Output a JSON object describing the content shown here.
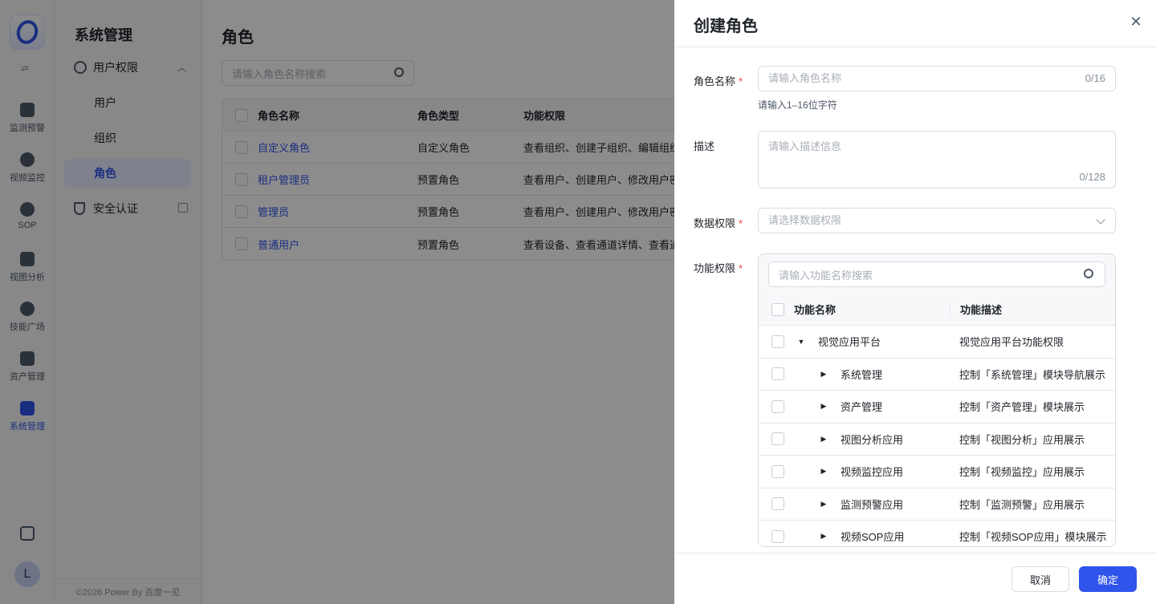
{
  "rail": {
    "items": [
      {
        "label": "监测预警",
        "icon": "monitor-chart-icon"
      },
      {
        "label": "视频监控",
        "icon": "camera-icon"
      },
      {
        "label": "SOP",
        "icon": "sop-icon"
      },
      {
        "label": "视图分析",
        "icon": "view-analysis-icon"
      },
      {
        "label": "技能广场",
        "icon": "skills-icon"
      },
      {
        "label": "资产管理",
        "icon": "asset-icon"
      },
      {
        "label": "系统管理",
        "icon": "system-icon"
      }
    ],
    "avatar": "L"
  },
  "subnav": {
    "title": "系统管理",
    "group": "用户权限",
    "sub_items": [
      "用户",
      "组织",
      "角色"
    ],
    "security": "安全认证",
    "footer": "©2026 Power By 百度一见"
  },
  "main": {
    "title": "角色",
    "search_placeholder": "请输入角色名称搜索",
    "columns": [
      "角色名称",
      "角色类型",
      "功能权限"
    ],
    "rows": [
      {
        "name": "自定义角色",
        "type": "自定义角色",
        "perm": "查看组织、创建子组织、编辑组织..."
      },
      {
        "name": "租户管理员",
        "type": "预置角色",
        "perm": "查看用户、创建用户、修改用户密..."
      },
      {
        "name": "管理员",
        "type": "预置角色",
        "perm": "查看用户、创建用户、修改用户密..."
      },
      {
        "name": "普通用户",
        "type": "预置角色",
        "perm": "查看设备、查看通道详情、查看通..."
      }
    ]
  },
  "drawer": {
    "title": "创建角色",
    "name_label": "角色名称",
    "name_placeholder": "请输入角色名称",
    "name_counter": "0/16",
    "name_hint": "请输入1–16位字符",
    "desc_label": "描述",
    "desc_placeholder": "请输入描述信息",
    "desc_counter": "0/128",
    "data_label": "数据权限",
    "data_placeholder": "请选择数据权限",
    "func_label": "功能权限",
    "func_search_placeholder": "请输入功能名称搜索",
    "func_columns": [
      "功能名称",
      "功能描述"
    ],
    "func_rows": [
      {
        "name": "视觉应用平台",
        "desc": "视觉应用平台功能权限"
      },
      {
        "name": "系统管理",
        "desc": "控制「系统管理」模块导航展示"
      },
      {
        "name": "资产管理",
        "desc": "控制「资产管理」模块展示"
      },
      {
        "name": "视图分析应用",
        "desc": "控制「视图分析」应用展示"
      },
      {
        "name": "视频监控应用",
        "desc": "控制「视频监控」应用展示"
      },
      {
        "name": "监测预警应用",
        "desc": "控制「监测预警」应用展示"
      },
      {
        "name": "视频SOP应用",
        "desc": "控制「视频SOP应用」模块展示"
      }
    ],
    "cancel": "取消",
    "ok": "确定"
  },
  "colors": {
    "accent": "#2f54eb",
    "required": "#f53f3f"
  }
}
